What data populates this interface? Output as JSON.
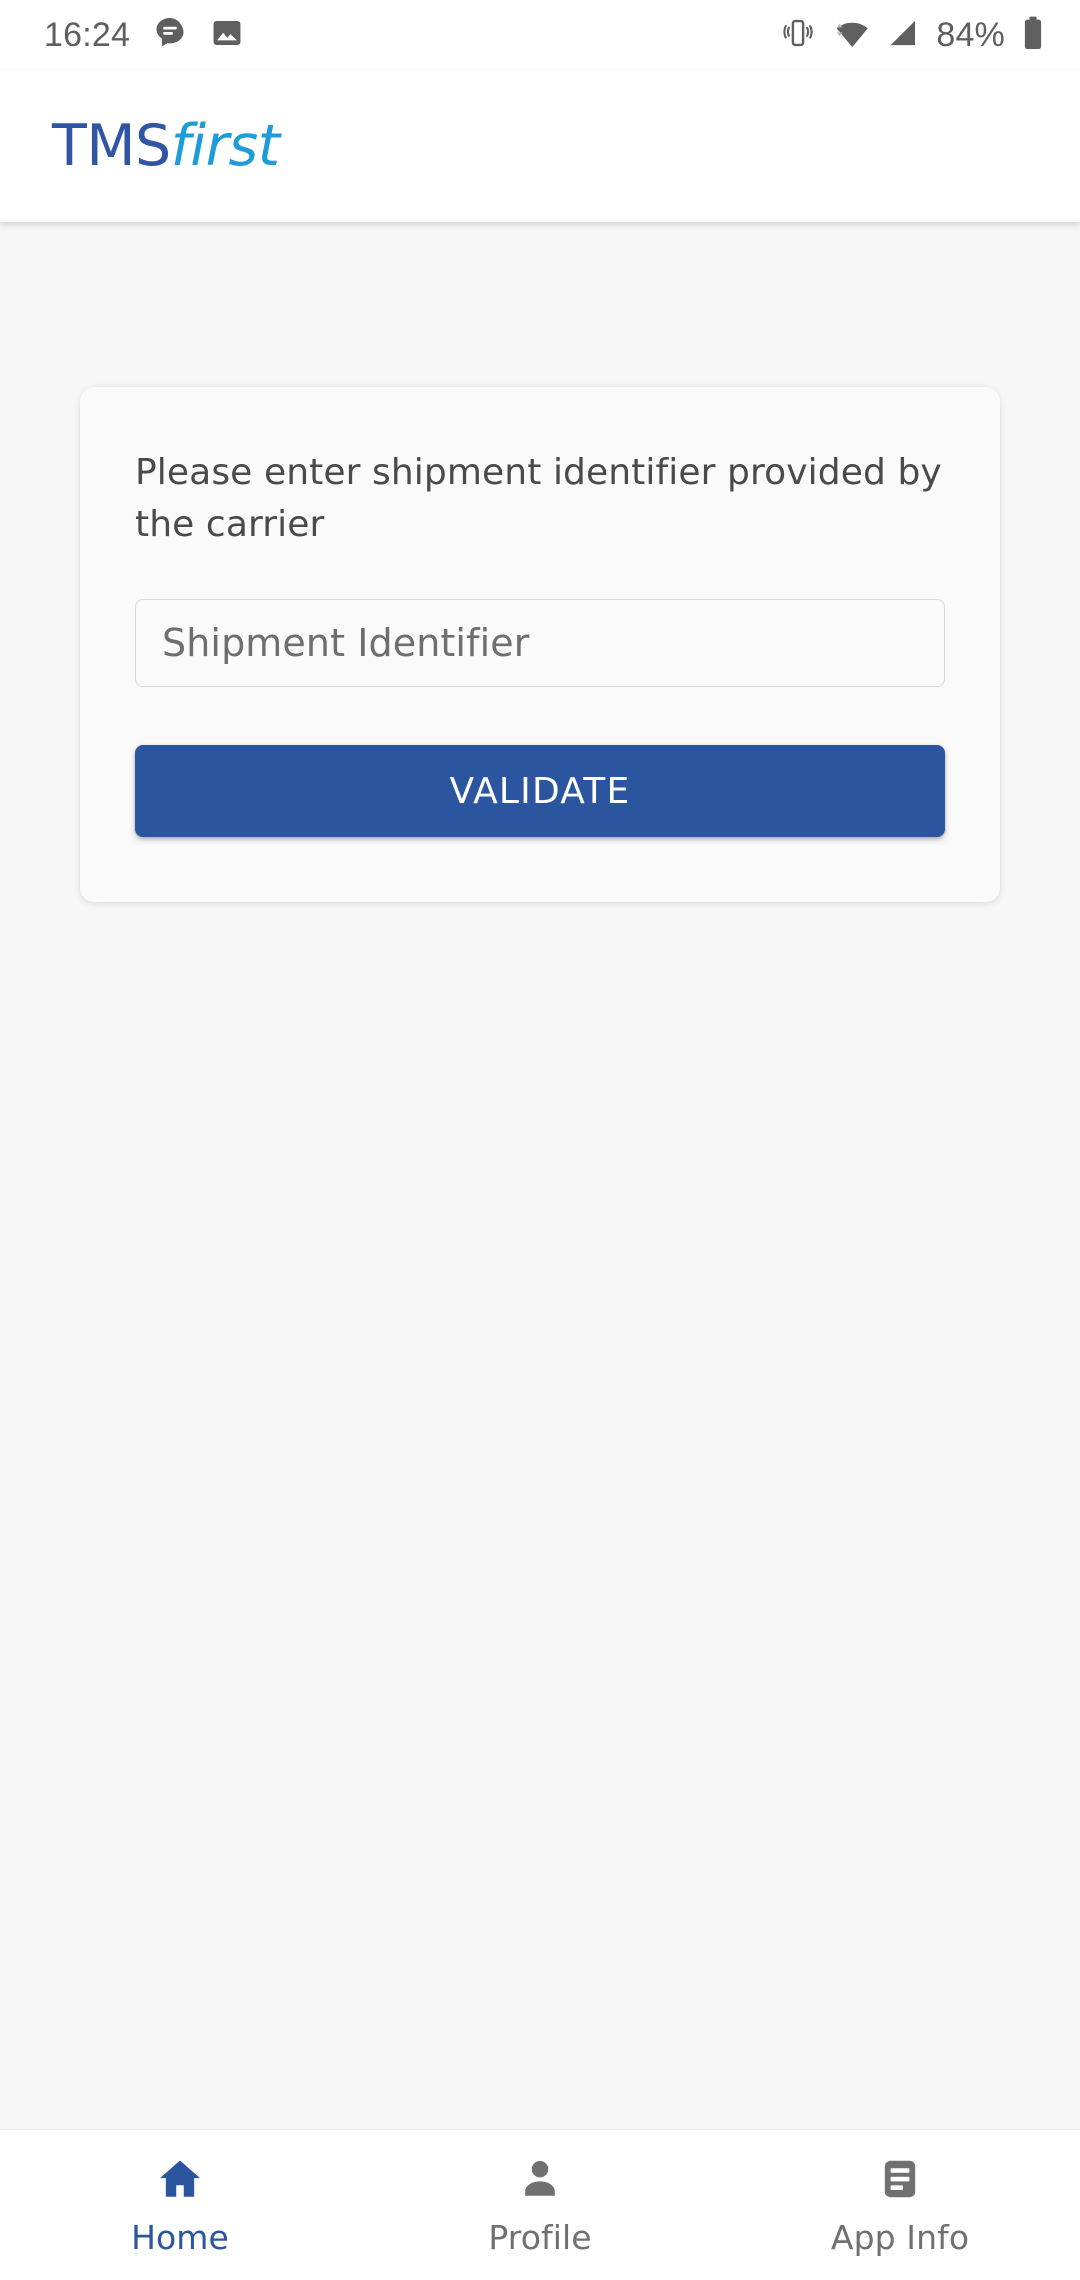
{
  "status_bar": {
    "time": "16:24",
    "battery_percent": "84%",
    "icons": {
      "notification_message": "message-bubble-icon",
      "notification_image": "image-icon",
      "vibrate": "vibrate-icon",
      "wifi": "wifi-icon",
      "cellular": "cellular-signal-icon",
      "battery": "battery-icon"
    },
    "text_color": "#5f5f5f"
  },
  "header": {
    "logo_primary": "TMS",
    "logo_secondary": "first",
    "logo_primary_color": "#2f55a4",
    "logo_secondary_color": "#1e9cd7",
    "background": "#ffffff"
  },
  "main": {
    "card": {
      "instruction": "Please enter shipment identifier provided by the carrier",
      "input": {
        "placeholder": "Shipment Identifier",
        "value": "",
        "name": "shipment-identifier-input"
      },
      "primary_button": {
        "label": "VALIDATE",
        "color": "#2b559f",
        "text_color": "#ffffff"
      },
      "background": "#fafafa"
    },
    "background": "#f7f7f7"
  },
  "bottom_nav": {
    "active_color": "#2b559f",
    "inactive_color": "#707070",
    "items": [
      {
        "label": "Home",
        "icon": "home-icon",
        "active": true
      },
      {
        "label": "Profile",
        "icon": "person-icon",
        "active": false
      },
      {
        "label": "App Info",
        "icon": "article-icon",
        "active": false
      }
    ]
  }
}
